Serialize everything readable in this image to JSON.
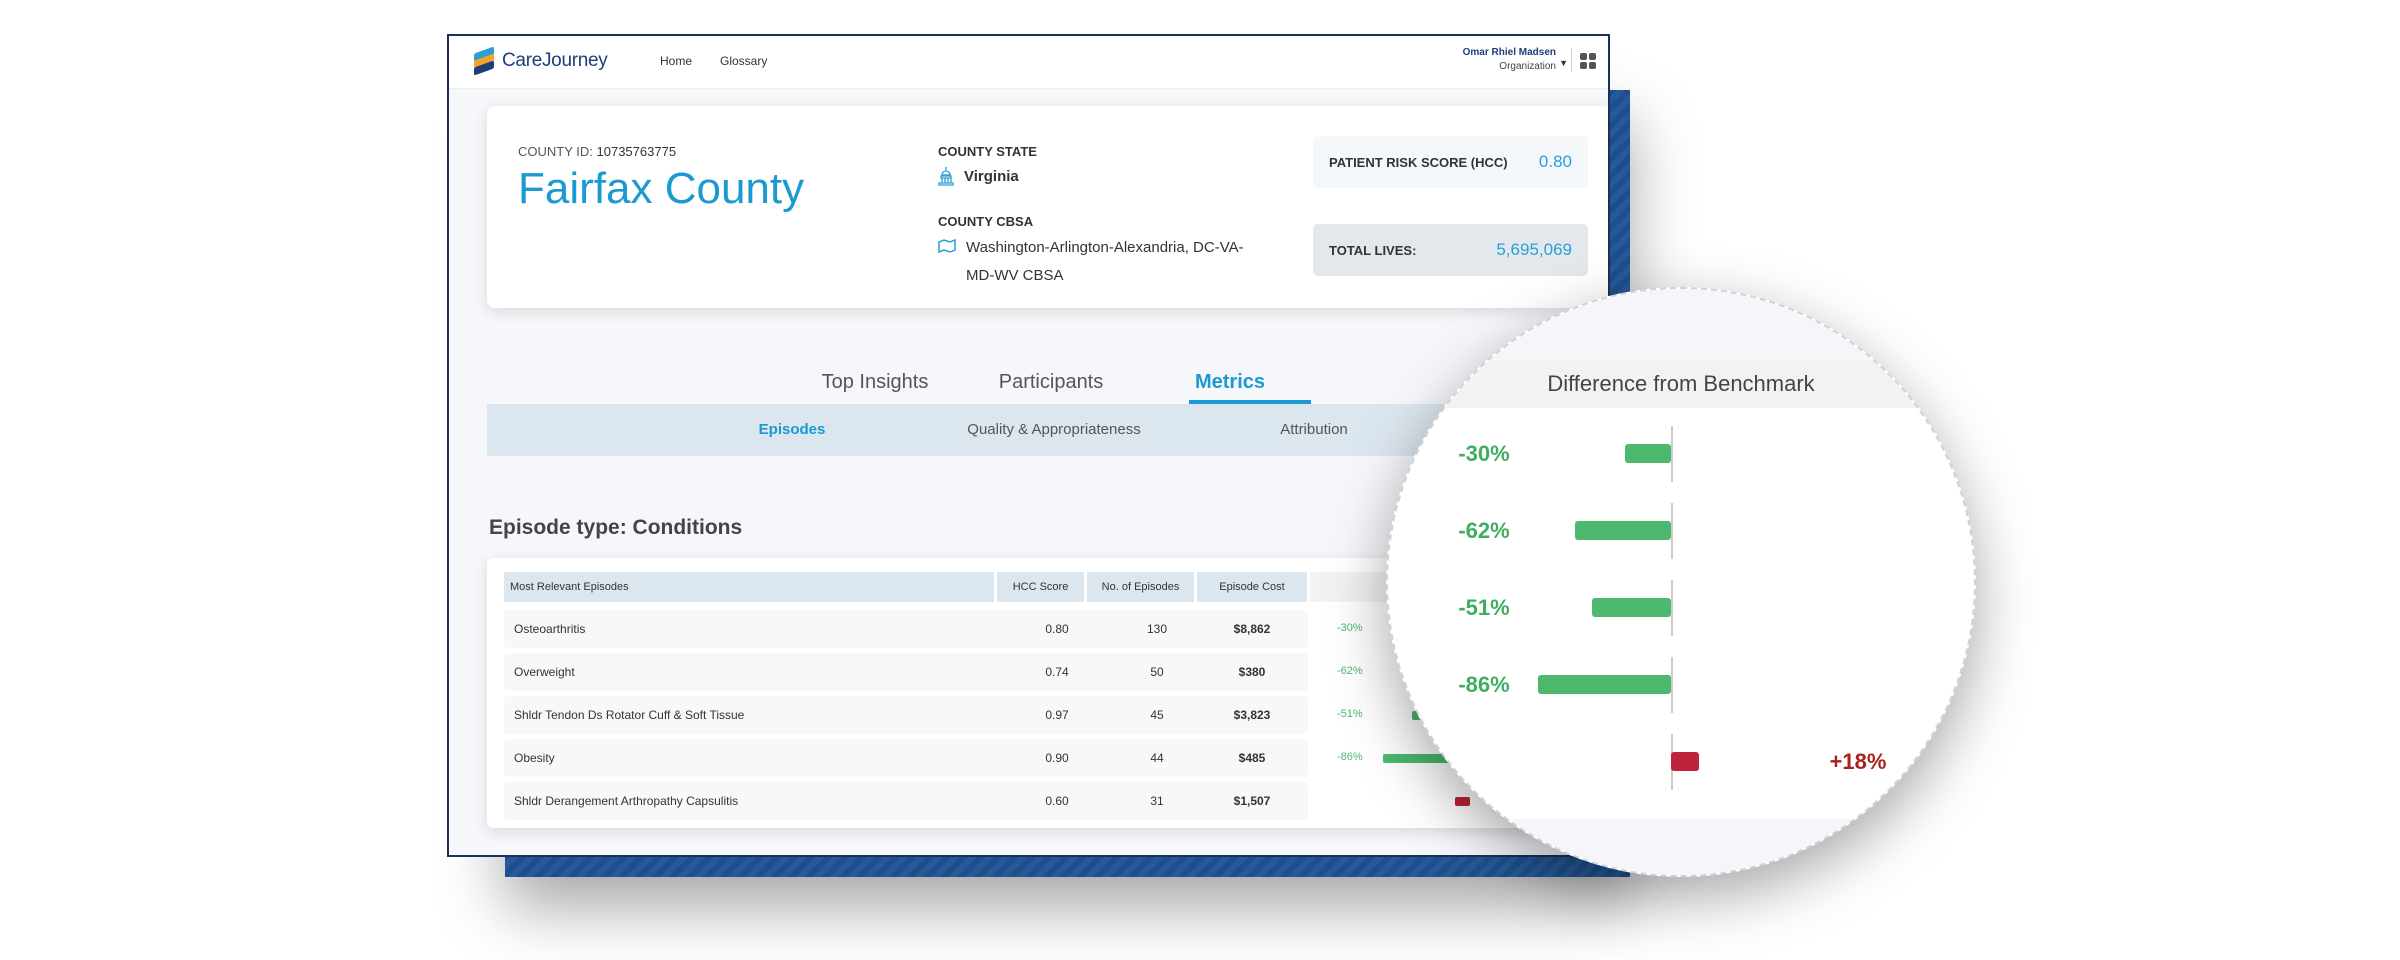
{
  "app": {
    "logo_text": "CareJourney",
    "nav": [
      "Home",
      "Glossary"
    ],
    "user_name": "Omar Rhiel Madsen",
    "user_org": "Organization"
  },
  "county": {
    "id_label": "COUNTY ID:",
    "id": "10735763775",
    "name": "Fairfax County",
    "state_label": "COUNTY STATE",
    "state": "Virginia",
    "cbsa_label": "COUNTY CBSA",
    "cbsa_line1": "Washington-Arlington-Alexandria, DC-VA-",
    "cbsa_line2": "MD-WV CBSA",
    "risk_label": "PATIENT RISK SCORE (HCC)",
    "risk": "0.80",
    "lives_label": "TOTAL LIVES:",
    "lives": "5,695,069"
  },
  "tabs": [
    "Top Insights",
    "Participants",
    "Metrics"
  ],
  "active_tab": "Metrics",
  "subtabs": [
    "Episodes",
    "Quality & Appropriateness",
    "Attribution"
  ],
  "active_subtab": "Episodes",
  "episode_title": "Episode type: Conditions",
  "table": {
    "headers": [
      "Most Relevant Episodes",
      "HCC Score",
      "No. of Episodes",
      "Episode Cost",
      "Difference from Benchmark"
    ],
    "rows": [
      {
        "name": "Osteoarthritis",
        "hcc": "0.80",
        "episodes": "130",
        "cost": "$8,862",
        "diff": -30,
        "diff_label": "-30%"
      },
      {
        "name": "Overweight",
        "hcc": "0.74",
        "episodes": "50",
        "cost": "$380",
        "diff": -62,
        "diff_label": "-62%"
      },
      {
        "name": "Shldr Tendon Ds Rotator Cuff & Soft Tissue",
        "hcc": "0.97",
        "episodes": "45",
        "cost": "$3,823",
        "diff": -51,
        "diff_label": "-51%"
      },
      {
        "name": "Obesity",
        "hcc": "0.90",
        "episodes": "44",
        "cost": "$485",
        "diff": -86,
        "diff_label": "-86%"
      },
      {
        "name": "Shldr Derangement Arthropathy Capsulitis",
        "hcc": "0.60",
        "episodes": "31",
        "cost": "$1,507",
        "diff": 18,
        "diff_label": "+18%"
      }
    ]
  },
  "colors": {
    "accent": "#1b9ad2",
    "better": "#4cb96e",
    "worse": "#c0223b",
    "navy": "#1d3e78"
  },
  "icons": {
    "state": "capitol-icon",
    "cbsa": "map-icon",
    "apps": "grid-icon",
    "logo": "carejourney-logo"
  }
}
